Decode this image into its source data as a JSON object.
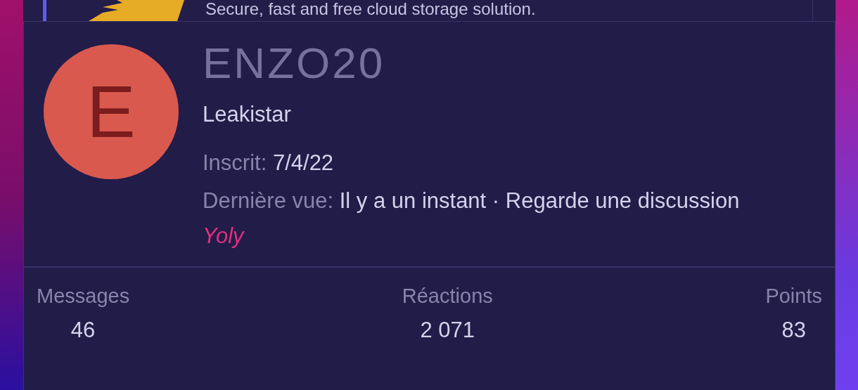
{
  "behind_card": {
    "description": "Secure, fast and free cloud storage solution."
  },
  "profile": {
    "avatar_letter": "E",
    "username": "ENZO20",
    "title": "Leakistar",
    "joined": {
      "label": "Inscrit:",
      "value": "7/4/22"
    },
    "last_seen": {
      "label": "Dernière vue:",
      "value": "Il y a un instant · Regarde une discussion",
      "link": "Yoly"
    }
  },
  "stats": [
    {
      "label": "Messages",
      "value": "46"
    },
    {
      "label": "Réactions",
      "value": "2 071"
    },
    {
      "label": "Points",
      "value": "83"
    }
  ]
}
